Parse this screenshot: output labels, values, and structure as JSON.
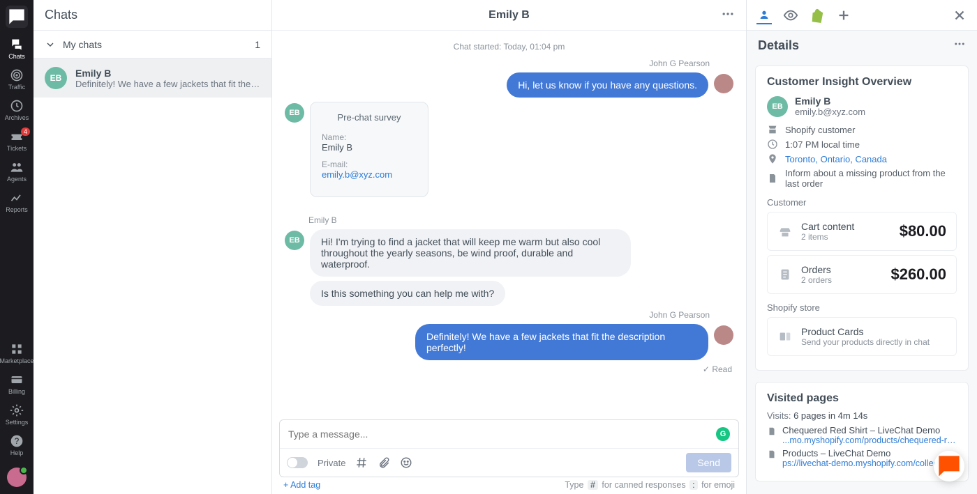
{
  "rail": {
    "items": [
      {
        "label": "Chats"
      },
      {
        "label": "Traffic"
      },
      {
        "label": "Archives"
      },
      {
        "label": "Tickets",
        "badge": "4"
      },
      {
        "label": "Agents"
      },
      {
        "label": "Reports"
      }
    ],
    "bottom": [
      {
        "label": "Marketplace"
      },
      {
        "label": "Billing"
      },
      {
        "label": "Settings"
      },
      {
        "label": "Help"
      }
    ]
  },
  "chats": {
    "header": "Chats",
    "section": "My chats",
    "count": "1",
    "items": [
      {
        "initials": "EB",
        "name": "Emily B",
        "snippet": "Definitely! We have a few jackets that fit the desc…"
      }
    ]
  },
  "conversation": {
    "title": "Emily B",
    "started": "Chat started: Today, 01:04 pm",
    "agent_name": "John G Pearson",
    "customer_name": "Emily B",
    "messages": {
      "agent1": "Hi, let us know if you have any questions.",
      "cust1": "Hi! I'm trying to find a jacket that will keep me warm but also cool throughout the yearly seasons, be wind proof, durable and waterproof.",
      "cust2": "Is this something you can help me with?",
      "agent2": "Definitely! We have a few jackets that fit the description perfectly!"
    },
    "survey": {
      "title": "Pre-chat survey",
      "name_label": "Name:",
      "name_value": "Emily B",
      "email_label": "E-mail:",
      "email_value": "emily.b@xyz.com"
    },
    "read": "Read",
    "composer": {
      "placeholder": "Type a message...",
      "private": "Private",
      "send": "Send",
      "add_tag": "+ Add tag",
      "hints_prefix": "Type",
      "hints_hash": "#",
      "hints_canned": "for canned responses",
      "hints_colon": ":",
      "hints_emoji": "for emoji"
    }
  },
  "details": {
    "title": "Details",
    "insight_title": "Customer Insight Overview",
    "user": {
      "initials": "EB",
      "name": "Emily B",
      "email": "emily.b@xyz.com"
    },
    "info": {
      "platform": "Shopify customer",
      "time": "1:07 PM local time",
      "location": "Toronto, Ontario, Canada",
      "note": "Inform about a missing product from the last order"
    },
    "customer_label": "Customer",
    "stats": {
      "cart": {
        "title": "Cart content",
        "sub": "2 items",
        "value": "$80.00"
      },
      "orders": {
        "title": "Orders",
        "sub": "2 orders",
        "value": "$260.00"
      }
    },
    "store_label": "Shopify store",
    "product_cards": {
      "title": "Product Cards",
      "sub": "Send your products directly in chat"
    },
    "visited": {
      "title": "Visited pages",
      "visits_label": "Visits:",
      "visits_value": "6 pages in 4m 14s",
      "pages": [
        {
          "title": "Chequered Red Shirt – LiveChat Demo",
          "url": "...mo.myshopify.com/products/chequered-re..."
        },
        {
          "title": "Products – LiveChat Demo",
          "url": "ps://livechat-demo.myshopify.com/collections/all"
        }
      ]
    }
  }
}
